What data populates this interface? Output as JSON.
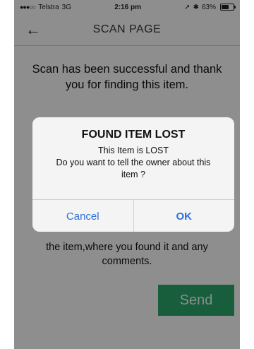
{
  "status_bar": {
    "signal_dots": "●●●○○",
    "carrier": "Telstra",
    "network": "3G",
    "time": "2:16 pm",
    "location_icon": "➚",
    "bluetooth_icon": "✱",
    "battery_percent": "63%",
    "battery_level": 0.63
  },
  "nav": {
    "back_icon": "←",
    "title": "SCAN PAGE"
  },
  "main": {
    "message": "Scan has been successful and thank you for finding this item.",
    "instructions": "the item,where you found it and any comments.",
    "send_label": "Send"
  },
  "alert": {
    "title": "FOUND ITEM LOST",
    "line1": "This Item is LOST",
    "line2": "Do you want to tell the owner about this item ?",
    "cancel_label": "Cancel",
    "ok_label": "OK"
  },
  "colors": {
    "send_button": "#2aa36a",
    "alert_button_text": "#2f6fd6"
  }
}
